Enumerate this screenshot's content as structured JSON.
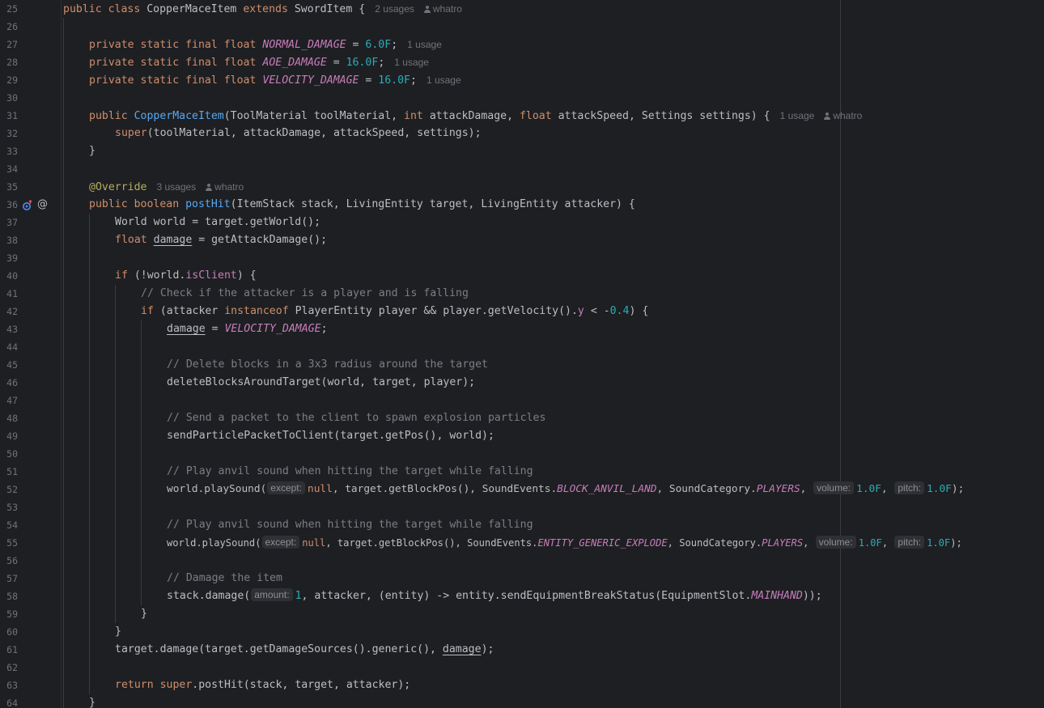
{
  "editor": {
    "language": "java",
    "icons": {
      "override_marker": "override-up-arrow-icon",
      "annotation_marker": "at-sign-icon",
      "author": "person-icon"
    },
    "colors": {
      "background": "#1e1f22",
      "keyword": "#cf8e6d",
      "function": "#56a8f5",
      "number": "#2aacb8",
      "constant": "#c77dbb",
      "annotation": "#b3ae60",
      "comment": "#7a7e85",
      "text": "#bcbec4"
    },
    "hints": {
      "usages_2": "2 usages",
      "usages_1": "1 usage",
      "usages_3": "3 usages",
      "author": "whatro",
      "except": "except:",
      "volume": "volume:",
      "pitch": "pitch:",
      "amount": "amount:"
    },
    "line_numbers": [
      "25",
      "26",
      "27",
      "28",
      "29",
      "30",
      "31",
      "32",
      "33",
      "34",
      "35",
      "36",
      "37",
      "38",
      "39",
      "40",
      "41",
      "42",
      "43",
      "44",
      "45",
      "46",
      "47",
      "48",
      "49",
      "50",
      "51",
      "52",
      "53",
      "54",
      "55",
      "56",
      "57",
      "58",
      "59",
      "60",
      "61",
      "62",
      "63",
      "64"
    ],
    "code": {
      "l25": {
        "a": "public class",
        "b": " CopperMaceItem ",
        "c": "extends",
        "d": " SwordItem {"
      },
      "l27": {
        "a": "private static final float ",
        "b": "NORMAL_DAMAGE",
        "c": " = ",
        "d": "6.0F",
        "e": ";"
      },
      "l28": {
        "a": "private static final float ",
        "b": "AOE_DAMAGE",
        "c": " = ",
        "d": "16.0F",
        "e": ";"
      },
      "l29": {
        "a": "private static final float ",
        "b": "VELOCITY_DAMAGE",
        "c": " = ",
        "d": "16.0F",
        "e": ";"
      },
      "l31": {
        "a": "public ",
        "b": "CopperMaceItem",
        "c": "(ToolMaterial toolMaterial, ",
        "d": "int",
        "e": " attackDamage, ",
        "f": "float",
        "g": " attackSpeed, Settings settings) {"
      },
      "l32": {
        "a": "super",
        "b": "(toolMaterial, attackDamage, attackSpeed, settings);"
      },
      "l33": {
        "a": "}"
      },
      "l35": {
        "a": "@Override"
      },
      "l36": {
        "a": "public boolean ",
        "b": "postHit",
        "c": "(ItemStack stack, LivingEntity target, LivingEntity attacker) {"
      },
      "l37": {
        "a": "World world = target.getWorld();"
      },
      "l38": {
        "a": "float",
        "b": " ",
        "c": "damage",
        "d": " = getAttackDamage();"
      },
      "l40": {
        "a": "if",
        "b": " (!world.",
        "c": "isClient",
        "d": ") {"
      },
      "l41": {
        "a": "// Check if the attacker is a player and is falling"
      },
      "l42": {
        "a": "if",
        "b": " (attacker ",
        "c": "instanceof",
        "d": " PlayerEntity player && player.getVelocity().",
        "e": "y",
        "f": " < -",
        "g": "0.4",
        "h": ") {"
      },
      "l43": {
        "a": "damage",
        "b": " = ",
        "c": "VELOCITY_DAMAGE",
        "d": ";"
      },
      "l45": {
        "a": "// Delete blocks in a 3x3 radius around the target"
      },
      "l46": {
        "a": "deleteBlocksAroundTarget(world, target, player);"
      },
      "l48": {
        "a": "// Send a packet to the client to spawn explosion particles"
      },
      "l49": {
        "a": "sendParticlePacketToClient(target.getPos(), world);"
      },
      "l51": {
        "a": "// Play anvil sound when hitting the target while falling"
      },
      "l52": {
        "a": "world.playSound(",
        "b": "null",
        "c": ", target.getBlockPos(), SoundEvents.",
        "d": "BLOCK_ANVIL_LAND",
        "e": ", SoundCategory.",
        "f": "PLAYERS",
        "g": ", ",
        "h": "1.0F",
        "i": ", ",
        "j": "1.0F",
        "k": ");"
      },
      "l54": {
        "a": "// Play anvil sound when hitting the target while falling"
      },
      "l55": {
        "a": "world.playSound(",
        "b": "null",
        "c": ", target.getBlockPos(), SoundEvents.",
        "d": "ENTITY_GENERIC_EXPLODE",
        "e": ", SoundCategory.",
        "f": "PLAYERS",
        "g": ", ",
        "h": "1.0F",
        "i": ", ",
        "j": "1.0F",
        "k": ");"
      },
      "l57": {
        "a": "// Damage the item"
      },
      "l58": {
        "a": "stack.damage(",
        "b": "1",
        "c": ", attacker, (entity) -> entity.sendEquipmentBreakStatus(EquipmentSlot.",
        "d": "MAINHAND",
        "e": "));"
      },
      "l59": {
        "a": "}"
      },
      "l60": {
        "a": "}"
      },
      "l61": {
        "a": "target.damage(target.getDamageSources().generic(), ",
        "b": "damage",
        "c": ");"
      },
      "l63": {
        "a": "return super",
        "b": ".postHit(stack, target, attacker);"
      },
      "l64": {
        "a": "}"
      }
    }
  }
}
